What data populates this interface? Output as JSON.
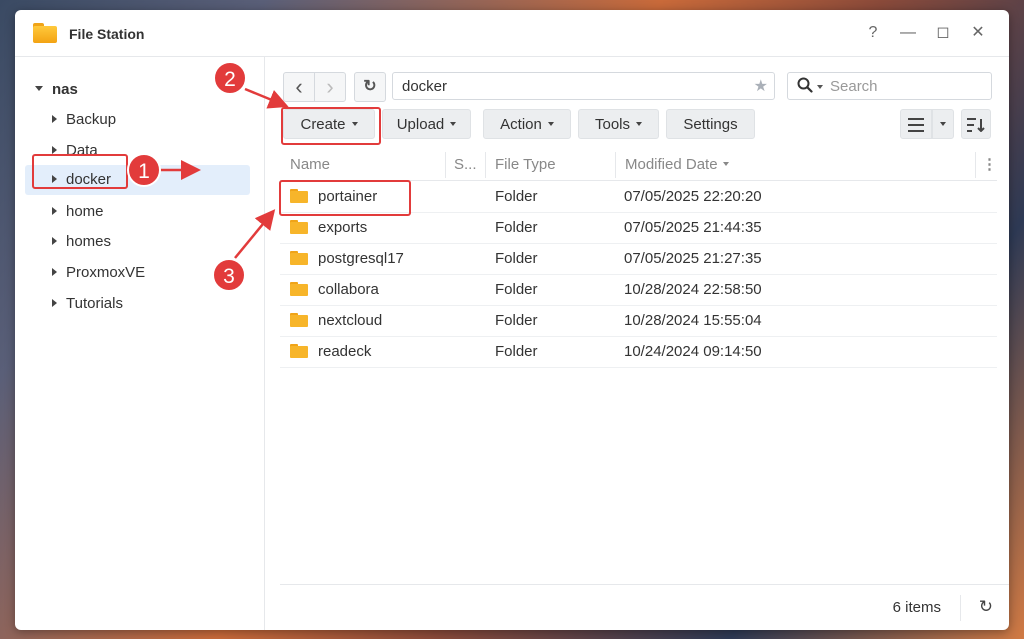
{
  "window": {
    "title": "File Station",
    "controls": {
      "help": "?",
      "minimize": "—",
      "maximize": "◻",
      "close": "✕"
    }
  },
  "sidebar": {
    "root": "nas",
    "items": [
      {
        "label": "Backup"
      },
      {
        "label": "Data"
      },
      {
        "label": "docker",
        "selected": true
      },
      {
        "label": "home"
      },
      {
        "label": "homes"
      },
      {
        "label": "ProxmoxVE"
      },
      {
        "label": "Tutorials"
      }
    ]
  },
  "nav": {
    "back_icon": "‹",
    "forward_icon": "›",
    "refresh_icon": "↻",
    "path": "docker",
    "star_icon": "★",
    "search_placeholder": "Search"
  },
  "toolbar": {
    "create": "Create",
    "upload": "Upload",
    "action": "Action",
    "tools": "Tools",
    "settings": "Settings"
  },
  "table": {
    "columns": {
      "name": "Name",
      "size": "S...",
      "type": "File Type",
      "modified": "Modified Date"
    },
    "rows": [
      {
        "name": "portainer",
        "type": "Folder",
        "modified": "07/05/2025 22:20:20"
      },
      {
        "name": "exports",
        "type": "Folder",
        "modified": "07/05/2025 21:44:35"
      },
      {
        "name": "postgresql17",
        "type": "Folder",
        "modified": "07/05/2025 21:27:35"
      },
      {
        "name": "collabora",
        "type": "Folder",
        "modified": "10/28/2024 22:58:50"
      },
      {
        "name": "nextcloud",
        "type": "Folder",
        "modified": "10/28/2024 15:55:04"
      },
      {
        "name": "readeck",
        "type": "Folder",
        "modified": "10/24/2024 09:14:50"
      }
    ]
  },
  "footer": {
    "count": "6 items"
  },
  "annotations": {
    "step1": "1",
    "step2": "2",
    "step3": "3",
    "color": "#e23b3b"
  }
}
